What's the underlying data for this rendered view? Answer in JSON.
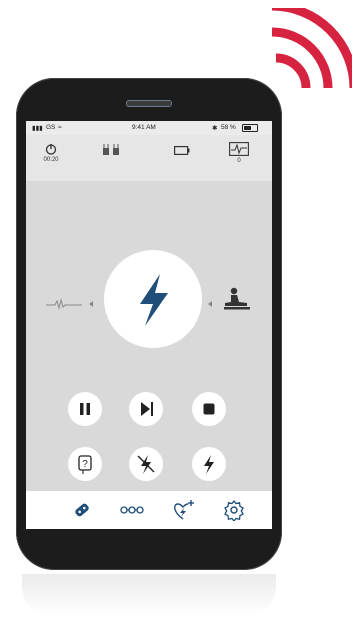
{
  "colors": {
    "accent": "#1f4e79",
    "signal": "#d6233f",
    "screen_bg": "#d9d9d9"
  },
  "status_bar": {
    "carrier": "GS",
    "time": "9:41 AM",
    "battery_percent": "58 %"
  },
  "top_bar": {
    "timer_value": "00:20",
    "rhythm_counter": "0",
    "icons": [
      "power-timer-icon",
      "electrode-pads-icon",
      "battery-icon",
      "ecg-monitor-icon"
    ]
  },
  "main": {
    "left_icon": "ecg-waveform-icon",
    "center_icon": "shock-bolt-icon",
    "right_icon": "cpr-icon"
  },
  "controls": {
    "row1": [
      "pause-icon",
      "skip-next-icon",
      "stop-icon"
    ],
    "row2": [
      "help-icon",
      "shock-disabled-icon",
      "shock-icon"
    ],
    "row3": [
      "speedometer-low-icon",
      "speedometer-high-icon"
    ]
  },
  "bottom_nav": [
    "pads-icon",
    "connection-icon",
    "heart-shock-icon",
    "settings-gear-icon"
  ]
}
